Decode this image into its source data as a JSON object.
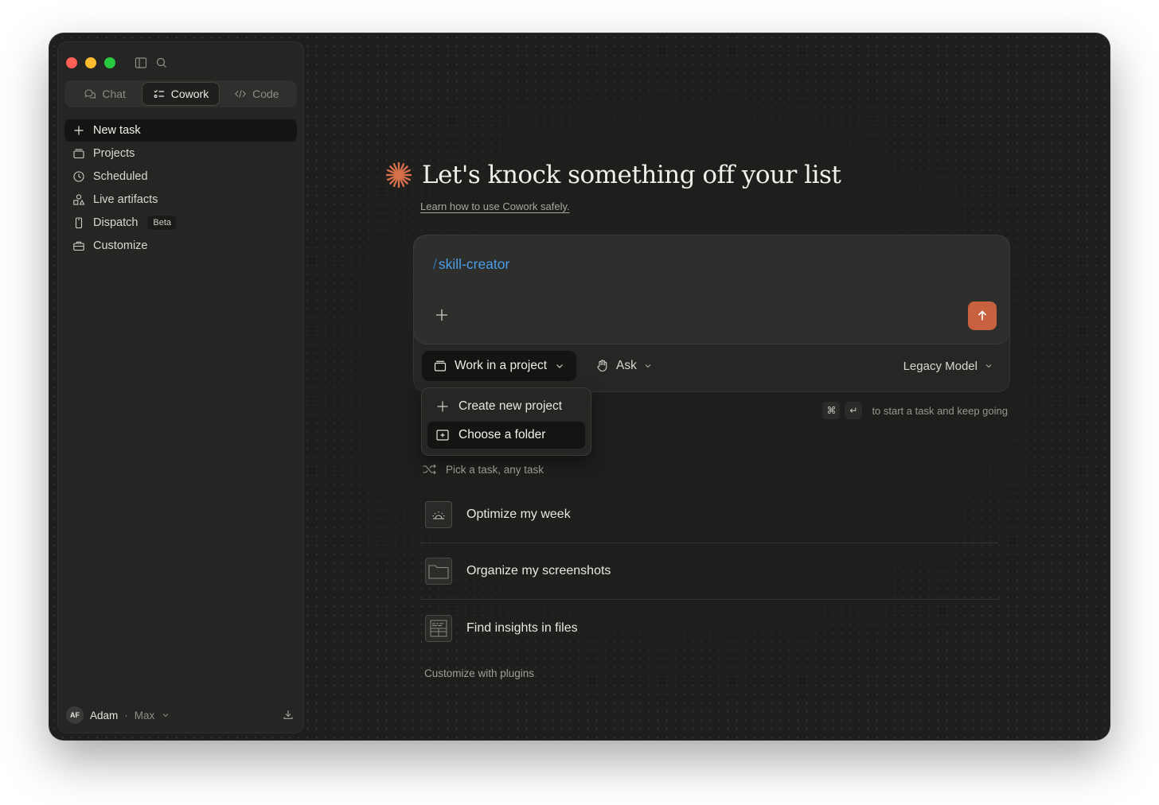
{
  "window": {
    "accent": "#c8613f"
  },
  "mode_tabs": [
    {
      "label": "Chat",
      "icon": "chat-bubbles-icon"
    },
    {
      "label": "Cowork",
      "icon": "checklist-icon",
      "active": true
    },
    {
      "label": "Code",
      "icon": "code-brackets-icon"
    }
  ],
  "nav": [
    {
      "label": "New task",
      "icon": "plus-icon",
      "active": true
    },
    {
      "label": "Projects",
      "icon": "folder-stack-icon"
    },
    {
      "label": "Scheduled",
      "icon": "clock-icon"
    },
    {
      "label": "Live artifacts",
      "icon": "shapes-icon"
    },
    {
      "label": "Dispatch",
      "icon": "phone-icon",
      "badge": "Beta"
    },
    {
      "label": "Customize",
      "icon": "briefcase-icon"
    }
  ],
  "user": {
    "initials": "AF",
    "name": "Adam",
    "separator": "·",
    "plan": "Max"
  },
  "main": {
    "heading": "Let's knock something off your list",
    "learn_link": "Learn how to use Cowork safely.",
    "composer": {
      "slash": "/",
      "command": "skill-creator"
    },
    "toolbar": {
      "project_label": "Work in a project",
      "ask_label": "Ask",
      "model_label": "Legacy Model"
    },
    "dropdown": {
      "items": [
        "Create new project",
        "Choose a folder"
      ]
    },
    "hint": {
      "key1": "⌘",
      "key2": "↵",
      "text": "to start a task and keep going"
    },
    "pick_label": "Pick a task, any task",
    "tasks": [
      {
        "label": "Optimize my week",
        "icon": "sunrise-calendar-icon"
      },
      {
        "label": "Organize my screenshots",
        "icon": "folder-icon"
      },
      {
        "label": "Find insights in files",
        "icon": "spreadsheet-icon"
      }
    ],
    "plugins_link": "Customize with plugins"
  }
}
